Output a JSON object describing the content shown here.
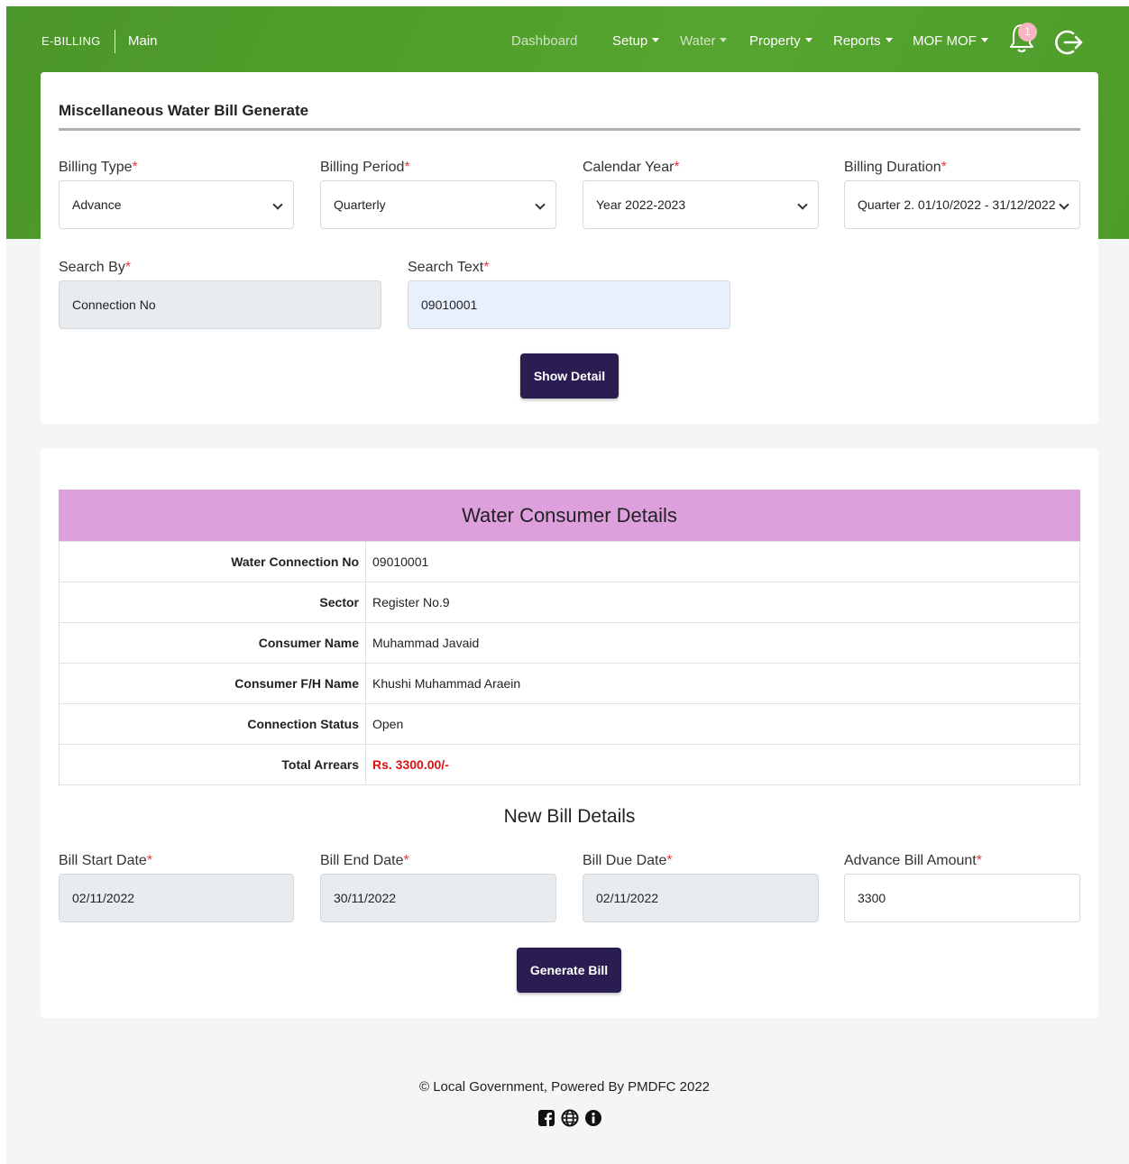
{
  "header": {
    "brand": "E-BILLING",
    "brand_main": "Main",
    "nav": {
      "dashboard": "Dashboard",
      "setup": "Setup",
      "water": "Water",
      "property": "Property",
      "reports": "Reports",
      "user": "MOF MOF"
    },
    "notification_count": "1"
  },
  "form": {
    "title": "Miscellaneous Water Bill Generate",
    "billing_type": {
      "label": "Billing Type",
      "value": "Advance"
    },
    "billing_period": {
      "label": "Billing Period",
      "value": "Quarterly"
    },
    "calendar_year": {
      "label": "Calendar Year",
      "value": "Year 2022-2023"
    },
    "billing_duration": {
      "label": "Billing Duration",
      "value": "Quarter 2. 01/10/2022 - 31/12/2022"
    },
    "search_by": {
      "label": "Search By",
      "value": "Connection No"
    },
    "search_text": {
      "label": "Search Text",
      "value": "09010001"
    },
    "required_mark": "*",
    "show_detail_label": "Show Detail"
  },
  "details": {
    "title": "Water Consumer Details",
    "rows": [
      {
        "key": "Water Connection No",
        "value": "09010001"
      },
      {
        "key": "Sector",
        "value": "Register No.9"
      },
      {
        "key": "Consumer Name",
        "value": "Muhammad Javaid"
      },
      {
        "key": "Consumer F/H Name",
        "value": "Khushi Muhammad Araein"
      },
      {
        "key": "Connection Status",
        "value": "Open"
      },
      {
        "key": "Total Arrears",
        "value": "Rs. 3300.00/-"
      }
    ]
  },
  "new_bill": {
    "title": "New Bill Details",
    "start_date": {
      "label": "Bill Start Date",
      "value": "02/11/2022"
    },
    "end_date": {
      "label": "Bill End Date",
      "value": "30/11/2022"
    },
    "due_date": {
      "label": "Bill Due Date",
      "value": "02/11/2022"
    },
    "amount": {
      "label": "Advance Bill Amount",
      "value": "3300"
    },
    "generate_label": "Generate Bill"
  },
  "footer": {
    "text": "© Local Government, Powered By PMDFC 2022",
    "icons": [
      "facebook-icon",
      "globe-icon",
      "info-icon"
    ]
  },
  "colors": {
    "header_green": "#4e9a2a",
    "button_purple": "#2a1d52",
    "details_header": "#dda0dd",
    "arrears_red": "#e01010",
    "required_red": "#e63946"
  }
}
